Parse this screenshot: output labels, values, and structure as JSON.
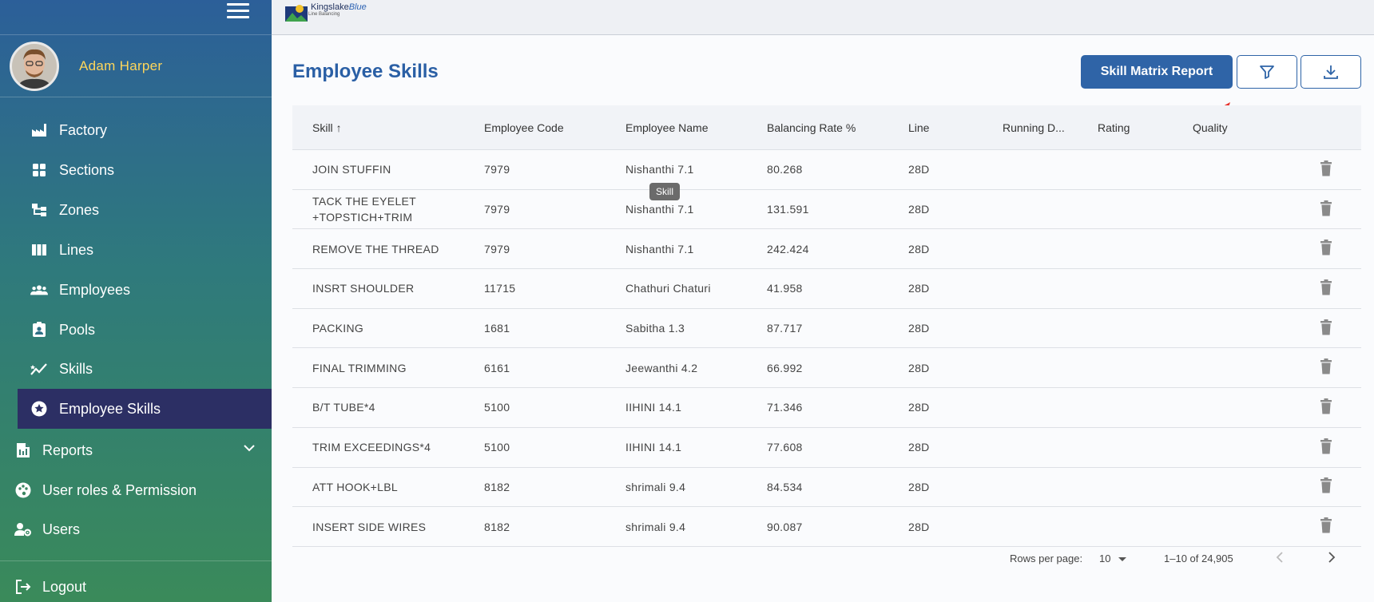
{
  "sidebar": {
    "user_name": "Adam  Harper",
    "items": [
      {
        "label": "Factory",
        "icon": "factory-icon"
      },
      {
        "label": "Sections",
        "icon": "grid-icon"
      },
      {
        "label": "Zones",
        "icon": "hierarchy-icon"
      },
      {
        "label": "Lines",
        "icon": "columns-icon"
      },
      {
        "label": "Employees",
        "icon": "people-icon"
      },
      {
        "label": "Pools",
        "icon": "badge-icon"
      },
      {
        "label": "Skills",
        "icon": "trend-icon"
      },
      {
        "label": "Employee Skills",
        "icon": "star-circle-icon",
        "active": true
      }
    ],
    "reports": "Reports",
    "user_roles": "User roles & Permission",
    "users": "Users",
    "logout": "Logout"
  },
  "topbar": {
    "logo_name_dark": "Kingslake",
    "logo_name_blue": "Blue",
    "logo_sub": "Line Balancing"
  },
  "main": {
    "title": "Employee Skills",
    "report_button": "Skill Matrix Report",
    "tooltip": "Skill",
    "columns": [
      "Skill",
      "Employee Code",
      "Employee Name",
      "Balancing Rate %",
      "Line",
      "Running D...",
      "Rating",
      "Quality"
    ],
    "sort_indicator": "↑",
    "rows": [
      {
        "skill": "JOIN STUFFIN",
        "code": "7979",
        "name": "Nishanthi 7.1",
        "rate": "80.268",
        "line": "28D"
      },
      {
        "skill": "TACK THE EYELET +TOPSTICH+TRIM",
        "code": "7979",
        "name": "Nishanthi 7.1",
        "rate": "131.591",
        "line": "28D"
      },
      {
        "skill": "REMOVE THE THREAD",
        "code": "7979",
        "name": "Nishanthi 7.1",
        "rate": "242.424",
        "line": "28D"
      },
      {
        "skill": "INSRT SHOULDER",
        "code": "11715",
        "name": "Chathuri Chaturi",
        "rate": "41.958",
        "line": "28D"
      },
      {
        "skill": "PACKING",
        "code": "1681",
        "name": "Sabitha 1.3",
        "rate": "87.717",
        "line": "28D"
      },
      {
        "skill": "FINAL TRIMMING",
        "code": "6161",
        "name": "Jeewanthi 4.2",
        "rate": "66.992",
        "line": "28D"
      },
      {
        "skill": "B/T TUBE*4",
        "code": "5100",
        "name": "IIHINI 14.1",
        "rate": "71.346",
        "line": "28D"
      },
      {
        "skill": "TRIM EXCEEDINGS*4",
        "code": "5100",
        "name": "IIHINI 14.1",
        "rate": "77.608",
        "line": "28D"
      },
      {
        "skill": "ATT HOOK+LBL",
        "code": "8182",
        "name": "shrimali 9.4",
        "rate": "84.534",
        "line": "28D"
      },
      {
        "skill": "INSERT SIDE WIRES",
        "code": "8182",
        "name": "shrimali 9.4",
        "rate": "90.087",
        "line": "28D"
      }
    ],
    "pagination": {
      "rows_per_page_label": "Rows per page:",
      "rows_per_page": "10",
      "range": "1–10 of 24,905"
    }
  },
  "colors": {
    "primary": "#2f64a7",
    "active_nav": "#2c2f64",
    "user_name": "#ffd65a",
    "arrow": "#e8302a"
  }
}
